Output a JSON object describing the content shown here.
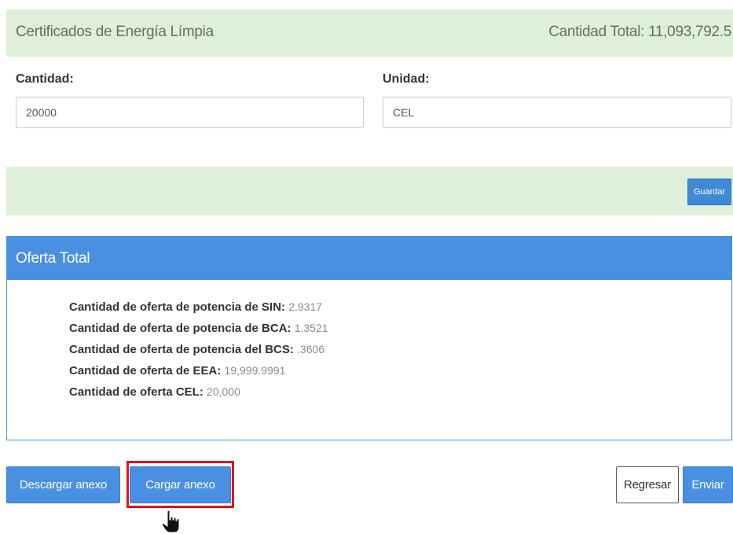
{
  "cel_panel": {
    "title": "Certificados de Energía Límpia",
    "total_text": "Cantidad Total: 11,093,792.5",
    "cantidad_label": "Cantidad:",
    "cantidad_value": "20000",
    "unidad_label": "Unidad:",
    "unidad_value": "CEL",
    "save_label": "Guardar"
  },
  "oferta_panel": {
    "title": "Oferta Total",
    "rows": [
      {
        "label": "Cantidad de oferta de potencia de SIN:",
        "value": "2.9317"
      },
      {
        "label": "Cantidad de oferta de potencia de BCA:",
        "value": "1.3521"
      },
      {
        "label": "Cantidad de oferta de potencia del BCS:",
        "value": ".3606"
      },
      {
        "label": "Cantidad de oferta de EEA:",
        "value": "19,999.9991"
      },
      {
        "label": "Cantidad de oferta CEL:",
        "value": "20,000"
      }
    ]
  },
  "actions": {
    "download_label": "Descargar anexo",
    "upload_label": "Cargar anexo",
    "back_label": "Regresar",
    "send_label": "Enviar"
  },
  "colors": {
    "panel_green": "#dff0d8",
    "primary_blue": "#4a90e2",
    "highlight_red": "#e1131b"
  },
  "icons": {
    "cursor": "hand-pointer-icon"
  }
}
